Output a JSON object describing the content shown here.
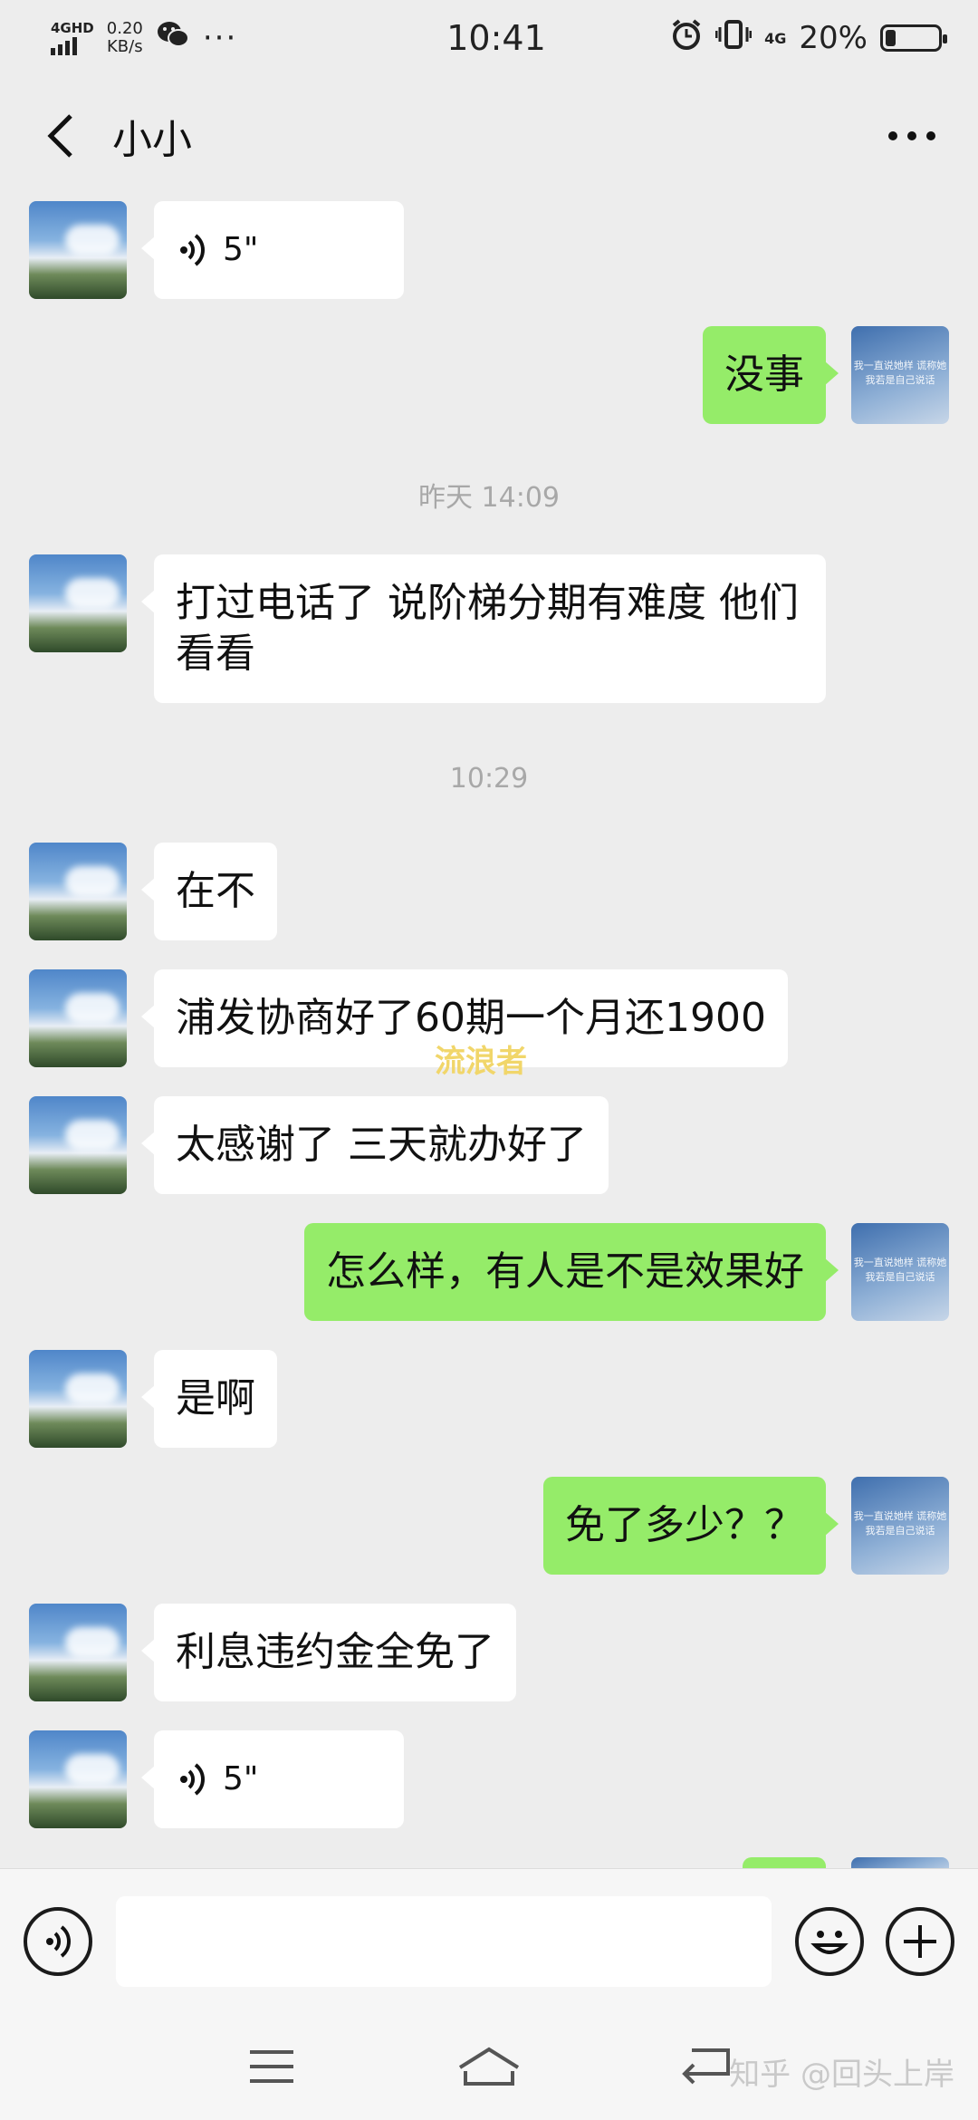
{
  "status_bar": {
    "network": "4GHD",
    "speed_value": "0.20",
    "speed_unit": "KB/s",
    "time": "10:41",
    "signal_type": "4G",
    "battery_percent": "20%",
    "battery_level": 0.2
  },
  "header": {
    "title": "小小"
  },
  "avatar_text": "我一直说她样 谎称她我若是自己说话",
  "messages": {
    "m1": {
      "duration": "5\""
    },
    "m2": {
      "text": "没事"
    },
    "ts1": {
      "text": "昨天 14:09"
    },
    "m3": {
      "text": "打过电话了 说阶梯分期有难度 他们看看"
    },
    "ts2": {
      "text": "10:29"
    },
    "m4": {
      "text": "在不"
    },
    "m5": {
      "text": "浦发协商好了60期一个月还1900"
    },
    "m6": {
      "text": "太感谢了 三天就办好了"
    },
    "m7": {
      "text": "怎么样，有人是不是效果好"
    },
    "m8": {
      "text": "是啊"
    },
    "m9": {
      "text": "免了多少？？"
    },
    "m10": {
      "text": "利息违约金全免了"
    },
    "m11": {
      "duration": "5\""
    }
  },
  "chat_watermark": "流浪者",
  "watermark": "知乎 @回头上岸"
}
